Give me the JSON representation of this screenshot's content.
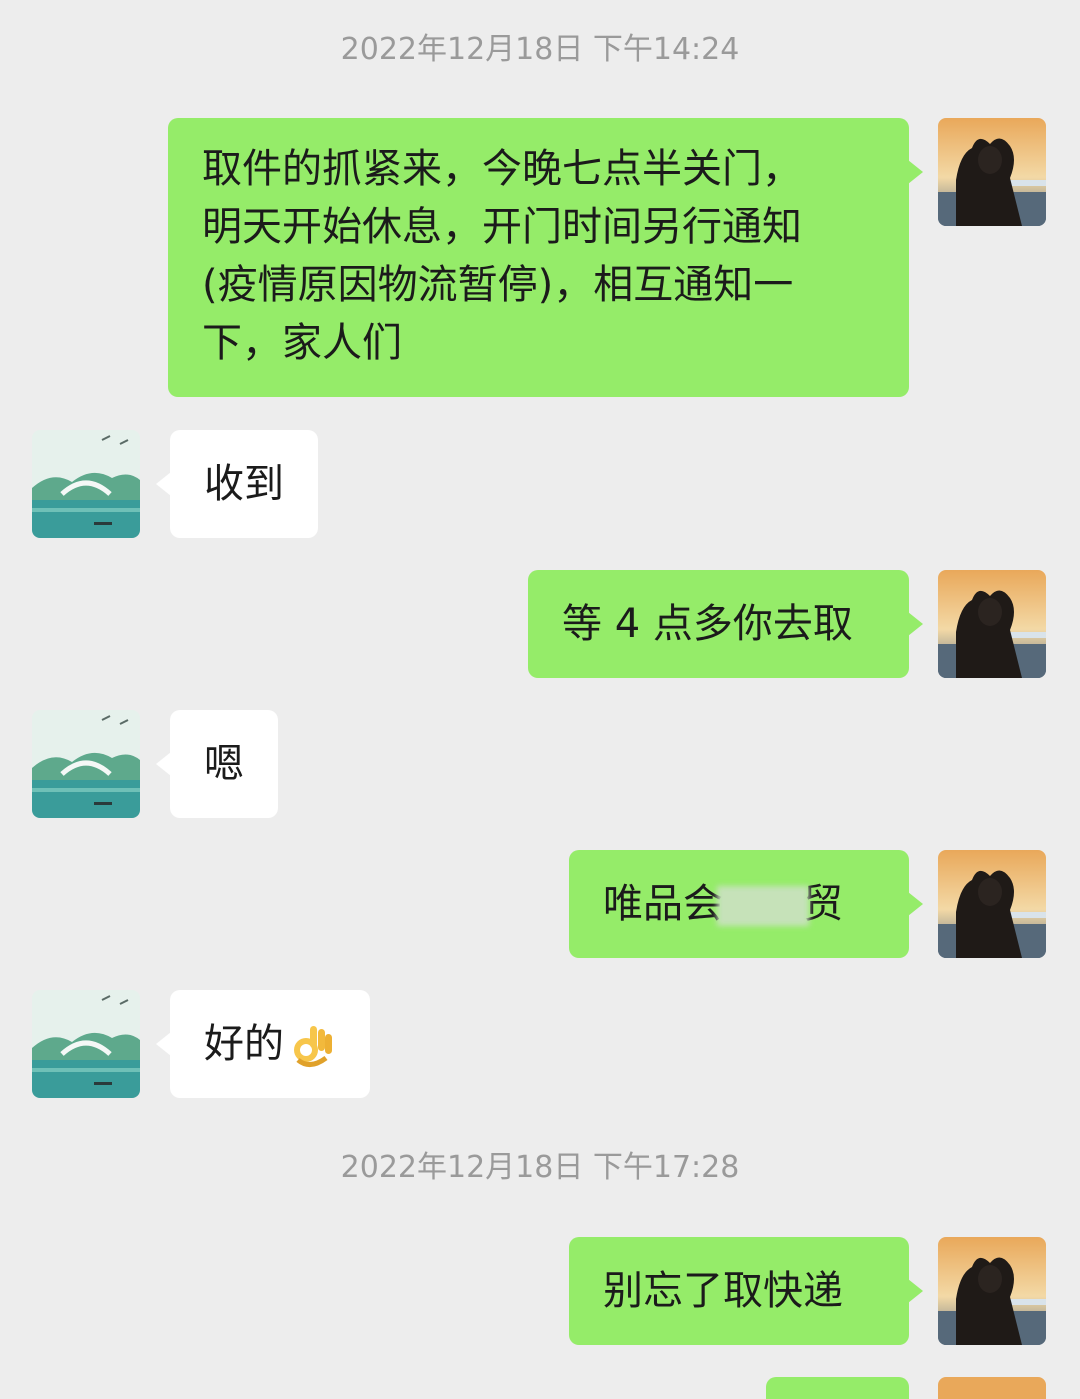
{
  "chat": {
    "timestamps": [
      "2022年12月18日 下午14:24",
      "2022年12月18日 下午17:28"
    ],
    "messages": [
      {
        "sender": "me",
        "text": "取件的抓紧来，今晚七点半关门，明天开始休息，开门时间另行通知(疫情原因物流暂停)，相互通知一下，家人们",
        "lines": [
          "取件的抓紧来，今晚七点半关门，",
          "明天开始休息，开门时间另行通知",
          "(疫情原因物流暂停)，相互通知一",
          "下，家人们"
        ]
      },
      {
        "sender": "them",
        "text": "收到"
      },
      {
        "sender": "me",
        "text": "等 4 点多你去取"
      },
      {
        "sender": "them",
        "text": "嗯"
      },
      {
        "sender": "me",
        "text_before": "唯品会",
        "text_after": "贸",
        "redacted": true
      },
      {
        "sender": "them",
        "text": "好的",
        "emoji": "ok-hand-emoji"
      },
      {
        "sender": "me",
        "text": "别忘了取快递"
      }
    ]
  },
  "avatars": {
    "me": "sunset-heart-hands-avatar",
    "them": "lake-bridge-landscape-avatar"
  },
  "colors": {
    "background": "#EDEDED",
    "my_bubble": "#95EC69",
    "their_bubble": "#FFFFFF",
    "timestamp_text": "#9A9A9A"
  }
}
